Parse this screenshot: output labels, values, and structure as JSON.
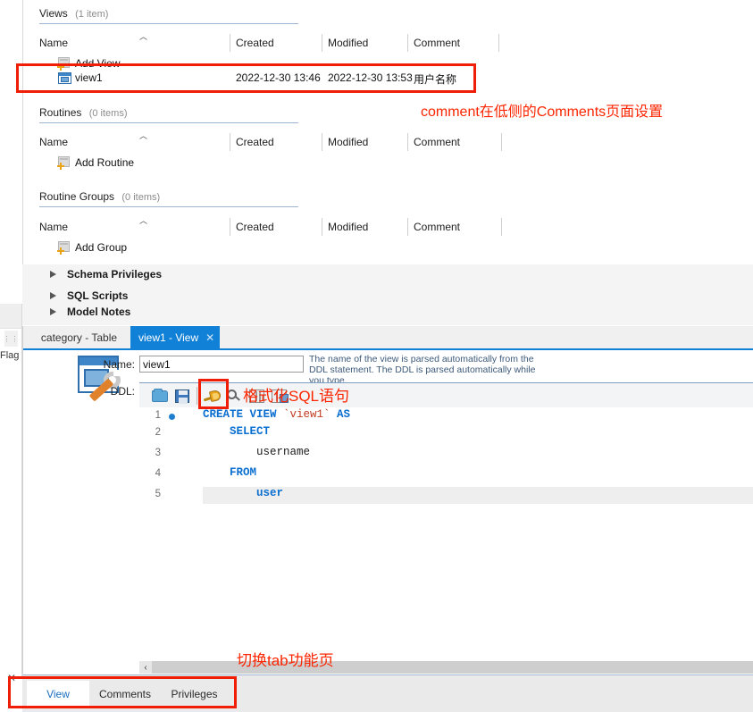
{
  "left_rail": {
    "flag_label": "Flag",
    "dots_glyph": "⋮⋮",
    "close_glyph": "✕"
  },
  "schema_sections": [
    {
      "name": "Views",
      "count": "(1 item)",
      "columns": [
        "Name",
        "Created",
        "Modified",
        "Comment"
      ],
      "add_row_label": "Add View",
      "rows": [
        {
          "name": "view1",
          "created": "2022-12-30 13:46",
          "modified": "2022-12-30 13:53",
          "comment": "用户名称"
        }
      ]
    },
    {
      "name": "Routines",
      "count": "(0 items)",
      "columns": [
        "Name",
        "Created",
        "Modified",
        "Comment"
      ],
      "add_row_label": "Add Routine",
      "rows": []
    },
    {
      "name": "Routine Groups",
      "count": "(0 items)",
      "columns": [
        "Name",
        "Created",
        "Modified",
        "Comment"
      ],
      "add_row_label": "Add Group",
      "rows": []
    }
  ],
  "tree_items": [
    {
      "label": "Schema Privileges"
    },
    {
      "label": "SQL Scripts"
    },
    {
      "label": "Model Notes"
    }
  ],
  "editor": {
    "tabs": [
      {
        "label": "category - Table",
        "active": false
      },
      {
        "label": "view1 - View",
        "active": true,
        "close_glyph": "✕"
      }
    ],
    "name_label": "Name:",
    "name_value": "view1",
    "ddl_label": "DDL:",
    "hint": "The name of the view is parsed automatically from the DDL statement. The DDL is parsed automatically while you type.",
    "toolbar_icons": [
      "open-folder-icon",
      "save-to-file-icon",
      "beautify-sql-broom-icon",
      "find-icon",
      "toggle-panels-icon",
      "add-panel-icon"
    ],
    "scroll_left_glyph": "‹",
    "code_lines": [
      {
        "num": "1",
        "breakpoint": true,
        "highlight": false,
        "tokens": [
          {
            "t": "CREATE VIEW ",
            "c": "kw"
          },
          {
            "t": "`view1`",
            "c": "idq"
          },
          {
            "t": " ",
            "c": "plain"
          },
          {
            "t": "AS",
            "c": "kw"
          }
        ]
      },
      {
        "num": "2",
        "breakpoint": false,
        "highlight": false,
        "tokens": [
          {
            "t": "    ",
            "c": "plain"
          },
          {
            "t": "SELECT",
            "c": "kw"
          }
        ]
      },
      {
        "num": "3",
        "breakpoint": false,
        "highlight": false,
        "tokens": [
          {
            "t": "        ",
            "c": "plain"
          },
          {
            "t": "username",
            "c": "plain"
          }
        ]
      },
      {
        "num": "4",
        "breakpoint": false,
        "highlight": false,
        "tokens": [
          {
            "t": "    ",
            "c": "plain"
          },
          {
            "t": "FROM",
            "c": "kw"
          }
        ]
      },
      {
        "num": "5",
        "breakpoint": false,
        "highlight": true,
        "tokens": [
          {
            "t": "        ",
            "c": "plain"
          },
          {
            "t": "user",
            "c": "kw"
          }
        ]
      }
    ]
  },
  "bottom_tabs": [
    {
      "label": "View",
      "active": true
    },
    {
      "label": "Comments",
      "active": false
    },
    {
      "label": "Privileges",
      "active": false
    }
  ],
  "annotations": [
    {
      "id": "comment",
      "text": "comment在低侧的Comments页面设置"
    },
    {
      "id": "format",
      "text": "格式化SQL语句"
    },
    {
      "id": "tab",
      "text": "切换tab功能页"
    }
  ],
  "colors": {
    "accent_blue": "#1180d7",
    "annotation_red": "#fb2500",
    "keyword_blue": "#0b6fd0",
    "identifier_red": "#c23a1f",
    "rule_blue": "#4d78a8"
  }
}
